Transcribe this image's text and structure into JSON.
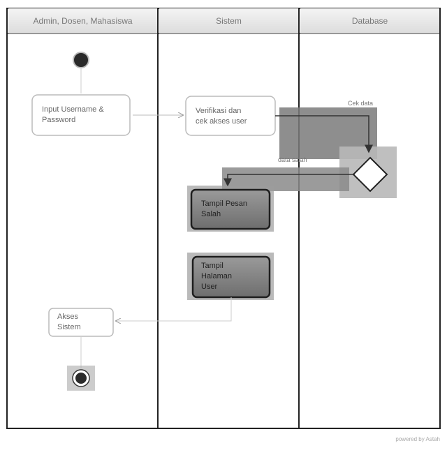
{
  "lanes": [
    {
      "id": "user",
      "label": "Admin, Dosen, Mahasiswa"
    },
    {
      "id": "system",
      "label": "Sistem"
    },
    {
      "id": "database",
      "label": "Database"
    }
  ],
  "nodes": {
    "input": {
      "lines": [
        "Input Username &",
        "Password"
      ]
    },
    "verify": {
      "lines": [
        "Verifikasi dan",
        "cek akses user"
      ]
    },
    "error": {
      "lines": [
        "Tampil Pesan",
        "Salah"
      ]
    },
    "show": {
      "lines": [
        "Tampil",
        "Halaman",
        "User"
      ]
    },
    "access": {
      "lines": [
        "Akses",
        "Sistem"
      ]
    }
  },
  "edges": {
    "check_label": "Cek data",
    "wrong_label": "data salah"
  },
  "footer": "powered by Astah",
  "colors": {
    "lane_line": "#222222",
    "node_border": "#bbbbbb",
    "dark_fill": "#808080",
    "shade": "#7a7a7a"
  }
}
